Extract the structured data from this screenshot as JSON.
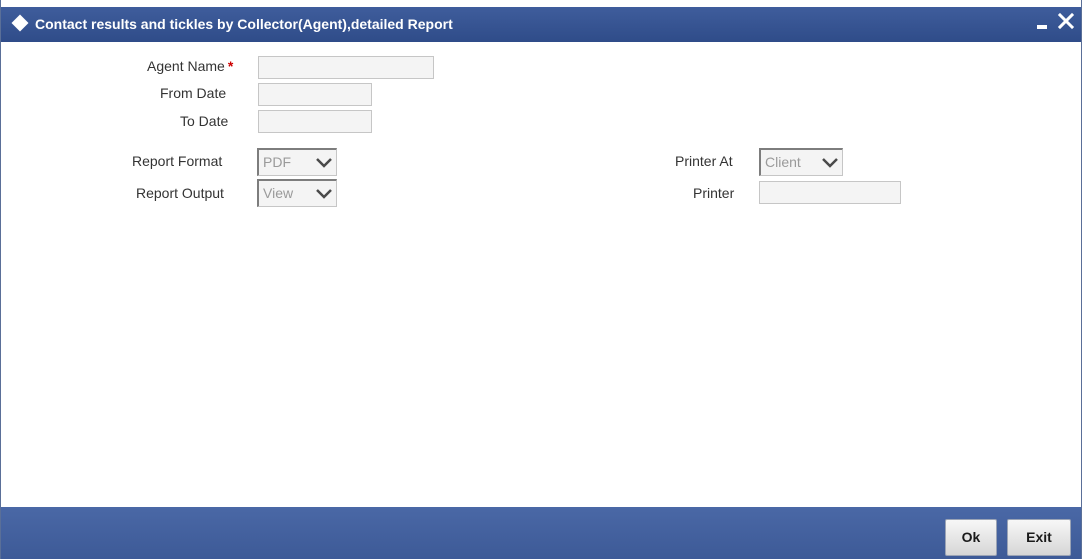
{
  "window": {
    "title": "Contact results and tickles by Collector(Agent),detailed Report"
  },
  "form": {
    "agent_name_label": "Agent Name",
    "required_mark": "*",
    "agent_name_value": "",
    "from_date_label": "From Date",
    "from_date_value": "",
    "to_date_label": "To Date",
    "to_date_value": "",
    "report_format_label": "Report Format",
    "report_format_value": "PDF",
    "report_output_label": "Report Output",
    "report_output_value": "View",
    "printer_at_label": "Printer At",
    "printer_at_value": "Client",
    "printer_label": "Printer",
    "printer_value": ""
  },
  "footer": {
    "ok_label": "Ok",
    "exit_label": "Exit"
  },
  "colors": {
    "titlebar": "#3f5d9c",
    "footer": "#4a68a6",
    "required": "#cc0000"
  },
  "icons": [
    "diamond-icon",
    "minimize-icon",
    "close-icon",
    "chevron-down-icon"
  ]
}
